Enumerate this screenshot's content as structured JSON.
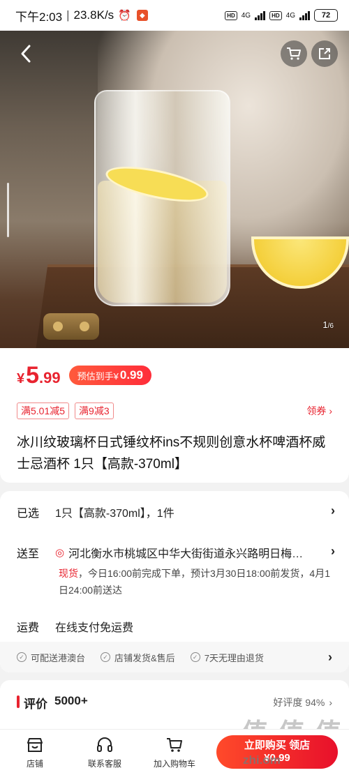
{
  "status_bar": {
    "time": "下午2:03",
    "speed": "23.8K/s",
    "network_1": "4G",
    "network_2": "4G",
    "hd": "HD",
    "battery": "72"
  },
  "gallery": {
    "current": "1",
    "total": "/6"
  },
  "price": {
    "symbol": "¥",
    "integer": "5",
    "decimal": ".99",
    "estimate_label": "预估到手¥",
    "estimate_value": "0.99"
  },
  "coupons": [
    "满5.01减5",
    "满9减3"
  ],
  "coupon_link": "领券",
  "product_title": "冰川纹玻璃杯日式锤纹杯ins不规则创意水杯啤酒杯威士忌酒杯 1只【高款-370ml】",
  "selected": {
    "label": "已选",
    "value": "1只【高款-370ml】，1件"
  },
  "delivery": {
    "label": "送至",
    "address": "河北衡水市桃城区中华大街街道永兴路明日梅…",
    "stock": "现货",
    "detail_1": "，今日16:00前完成下单，预计3月30日18:00前发货，4月1",
    "detail_2": "日24:00前送达"
  },
  "shipping": {
    "label": "运费",
    "value": "在线支付免运费"
  },
  "guarantees": [
    "可配送港澳台",
    "店铺发货&售后",
    "7天无理由退货"
  ],
  "reviews": {
    "title": "评价",
    "count": "5000+",
    "rate_label": "好评度 94%"
  },
  "bottom_nav": {
    "store": "店铺",
    "service": "联系客服",
    "cart": "加入购物车",
    "buy_line1": "立即购买 领店",
    "buy_line2": "¥0.99"
  },
  "watermark": {
    "main": "值 值 值",
    "sub": "zhi.om"
  },
  "colors": {
    "accent": "#e8232f",
    "buy_gradient_start": "#ff4a2a",
    "buy_gradient_end": "#e8102b"
  }
}
